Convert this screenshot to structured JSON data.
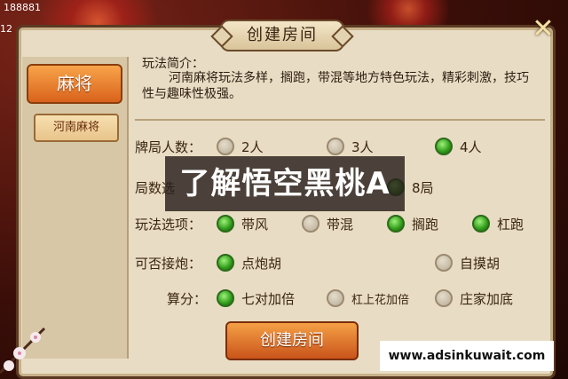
{
  "status": {
    "coins": "188881",
    "level": "12"
  },
  "dialog": {
    "title": "创建房间",
    "close_icon": "close-x-icon"
  },
  "sidebar": {
    "main_tab": "麻将",
    "sub_tab": "河南麻将"
  },
  "intro": {
    "title": "玩法简介：",
    "text": "河南麻将玩法多样，搁跑，带混等地方特色玩法，精彩刺激，技巧性与趣味性极强。"
  },
  "rows": {
    "rounds": {
      "label": "牌局人数：",
      "options": [
        {
          "label": "2人",
          "selected": false
        },
        {
          "label": "3人",
          "selected": false
        },
        {
          "label": "4人",
          "selected": true
        }
      ]
    },
    "games": {
      "label": "局数选",
      "options": [
        {
          "label": "8局",
          "selected": true
        }
      ]
    },
    "rules": {
      "label": "玩法选项：",
      "options": [
        {
          "label": "带风",
          "selected": true
        },
        {
          "label": "带混",
          "selected": false
        },
        {
          "label": "搁跑",
          "selected": true
        },
        {
          "label": "杠跑",
          "selected": true
        }
      ]
    },
    "pao": {
      "label": "可否接炮：",
      "options": [
        {
          "label": "点炮胡",
          "selected": true
        },
        {
          "label": "自摸胡",
          "selected": false
        }
      ]
    },
    "score": {
      "label": "算分：",
      "options": [
        {
          "label": "七对加倍",
          "selected": true
        },
        {
          "label": "杠上花加倍",
          "selected": false
        },
        {
          "label": "庄家加底",
          "selected": false
        }
      ]
    }
  },
  "create_button": "创建房间",
  "overlay_text": "了解悟空黑桃A",
  "watermark": "www.adsinkuwait.com"
}
